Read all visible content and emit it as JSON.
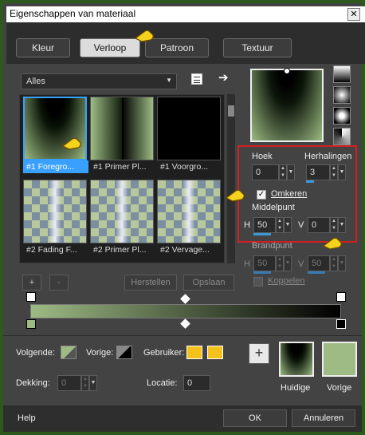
{
  "window": {
    "title": "Eigenschappen van materiaal",
    "close": "✕"
  },
  "tabs": [
    {
      "label": "Kleur"
    },
    {
      "label": "Verloop"
    },
    {
      "label": "Patroon"
    },
    {
      "label": "Textuur"
    }
  ],
  "category_select": {
    "value": "Alles"
  },
  "gallery": {
    "items": [
      {
        "label": "#1 Foregro..."
      },
      {
        "label": "#1 Primer Pl..."
      },
      {
        "label": "#1 Voorgro..."
      },
      {
        "label": "#2 Fading F..."
      },
      {
        "label": "#2 Primer Pl..."
      },
      {
        "label": "#2 Vervage..."
      }
    ]
  },
  "gallery_buttons": {
    "add": "+",
    "remove": "-",
    "restore": "Herstellen",
    "save": "Opslaan"
  },
  "settings": {
    "angle_label": "Hoek",
    "angle_value": "0",
    "repeats_label": "Herhalingen",
    "repeats_value": "3",
    "invert_label": "Omkeren",
    "invert_checked": true,
    "center_label": "Middelpunt",
    "center_h_label": "H",
    "center_h_value": "50",
    "center_v_label": "V",
    "center_v_value": "0",
    "focal_label": "Brandpunt",
    "focal_h_label": "H",
    "focal_h_value": "50",
    "focal_v_label": "V",
    "focal_v_value": "50",
    "link_label": "Koppelen",
    "link_checked": false
  },
  "bottom": {
    "next_label": "Volgende:",
    "prev_label": "Vorige:",
    "user_label": "Gebruiker:",
    "opacity_label": "Dekking:",
    "opacity_value": "0",
    "location_label": "Locatie:",
    "location_value": "0",
    "add_button": "+",
    "current_label": "Huidige",
    "previous_label": "Vorige"
  },
  "footer": {
    "help": "Help",
    "ok": "OK",
    "cancel": "Annuleren"
  },
  "colors": {
    "green": "#9dbb83",
    "selection": "#3aa0ff",
    "highlight": "#d02020",
    "user": "#f5c21b"
  }
}
